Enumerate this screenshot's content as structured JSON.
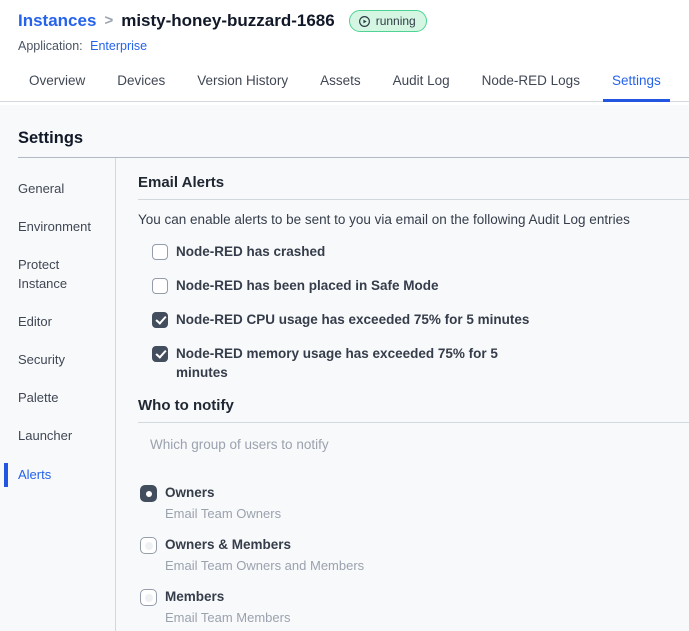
{
  "header": {
    "breadcrumb_root": "Instances",
    "breadcrumb_separator": ">",
    "instance_name": "misty-honey-buzzard-1686",
    "status": "running",
    "application_label": "Application:",
    "application_name": "Enterprise"
  },
  "tabs": [
    {
      "label": "Overview",
      "active": false
    },
    {
      "label": "Devices",
      "active": false
    },
    {
      "label": "Version History",
      "active": false
    },
    {
      "label": "Assets",
      "active": false
    },
    {
      "label": "Audit Log",
      "active": false
    },
    {
      "label": "Node-RED Logs",
      "active": false
    },
    {
      "label": "Settings",
      "active": true
    }
  ],
  "settings": {
    "title": "Settings",
    "sidebar": [
      {
        "label": "General",
        "active": false
      },
      {
        "label": "Environment",
        "active": false
      },
      {
        "label": "Protect Instance",
        "active": false
      },
      {
        "label": "Editor",
        "active": false
      },
      {
        "label": "Security",
        "active": false
      },
      {
        "label": "Palette",
        "active": false
      },
      {
        "label": "Launcher",
        "active": false
      },
      {
        "label": "Alerts",
        "active": true
      }
    ]
  },
  "email_alerts": {
    "title": "Email Alerts",
    "description": "You can enable alerts to be sent to you via email on the following Audit Log entries",
    "options": [
      {
        "label": "Node-RED has crashed",
        "checked": false
      },
      {
        "label": "Node-RED has been placed in Safe Mode",
        "checked": false
      },
      {
        "label": "Node-RED CPU usage has exceeded 75% for 5 minutes",
        "checked": true
      },
      {
        "label": "Node-RED memory usage has exceeded 75% for 5 minutes",
        "checked": true
      }
    ]
  },
  "who_to_notify": {
    "title": "Who to notify",
    "description": "Which group of users to notify",
    "options": [
      {
        "label": "Owners",
        "sublabel": "Email Team Owners",
        "selected": true
      },
      {
        "label": "Owners & Members",
        "sublabel": "Email Team Owners and Members",
        "selected": false
      },
      {
        "label": "Members",
        "sublabel": "Email Team Members",
        "selected": false
      }
    ]
  },
  "colors": {
    "accent_blue": "#2563eb",
    "active_underline": "#2255e0",
    "checked_control": "#424d5d",
    "badge_background": "#d4f6e3",
    "badge_border": "#4ed395",
    "content_background": "#f8f9fb"
  }
}
